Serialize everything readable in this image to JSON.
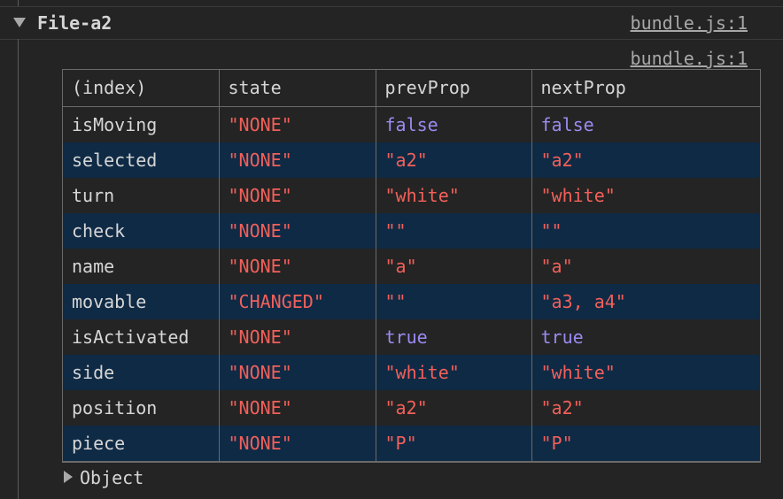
{
  "group": {
    "title": "File-a2",
    "source_link": "bundle.js:1"
  },
  "table_source_link": "bundle.js:1",
  "table": {
    "headers": [
      "(index)",
      "state",
      "prevProp",
      "nextProp"
    ],
    "rows": [
      {
        "index": "isMoving",
        "state": "\"NONE\"",
        "prev": "false",
        "next": "false",
        "prev_type": "bool",
        "next_type": "bool"
      },
      {
        "index": "selected",
        "state": "\"NONE\"",
        "prev": "\"a2\"",
        "next": "\"a2\"",
        "prev_type": "string",
        "next_type": "string"
      },
      {
        "index": "turn",
        "state": "\"NONE\"",
        "prev": "\"white\"",
        "next": "\"white\"",
        "prev_type": "string",
        "next_type": "string"
      },
      {
        "index": "check",
        "state": "\"NONE\"",
        "prev": "\"\"",
        "next": "\"\"",
        "prev_type": "string",
        "next_type": "string"
      },
      {
        "index": "name",
        "state": "\"NONE\"",
        "prev": "\"a\"",
        "next": "\"a\"",
        "prev_type": "string",
        "next_type": "string"
      },
      {
        "index": "movable",
        "state": "\"CHANGED\"",
        "prev": "\"\"",
        "next": "\"a3, a4\"",
        "prev_type": "string",
        "next_type": "string"
      },
      {
        "index": "isActivated",
        "state": "\"NONE\"",
        "prev": "true",
        "next": "true",
        "prev_type": "bool",
        "next_type": "bool"
      },
      {
        "index": "side",
        "state": "\"NONE\"",
        "prev": "\"white\"",
        "next": "\"white\"",
        "prev_type": "string",
        "next_type": "string"
      },
      {
        "index": "position",
        "state": "\"NONE\"",
        "prev": "\"a2\"",
        "next": "\"a2\"",
        "prev_type": "string",
        "next_type": "string"
      },
      {
        "index": "piece",
        "state": "\"NONE\"",
        "prev": "\"P\"",
        "next": "\"P\"",
        "prev_type": "string",
        "next_type": "string"
      }
    ]
  },
  "object_label": "Object",
  "colors": {
    "background": "#242424",
    "row_highlight": "#0f2a45",
    "string": "#f2605a",
    "boolean": "#9a8bf0",
    "text": "#d6d6d6",
    "link": "#a8a8a8"
  },
  "icons": {
    "group_toggle": "triangle-down-icon",
    "object_toggle": "triangle-right-icon"
  }
}
